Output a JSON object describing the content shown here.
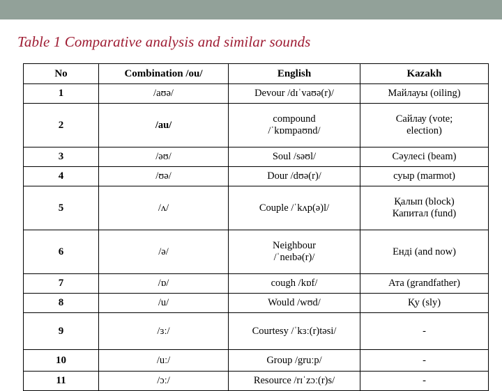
{
  "banner": {
    "color": "#92a199"
  },
  "title": {
    "text": "Table 1 Comparative analysis and similar sounds",
    "color": "#9e1b32"
  },
  "table": {
    "columns": [
      "No",
      "Combination /ou/",
      "English",
      "Kazakh"
    ],
    "rows": [
      {
        "no": "1",
        "combination": "/aʊə/",
        "combination_bold": false,
        "english_line1": "Devour /dɪˈvaʊə(r)/",
        "english_line2": "",
        "kazakh_line1": "Майлауы (oiling)",
        "kazakh_line2": ""
      },
      {
        "no": "2",
        "combination": "/au/",
        "combination_bold": true,
        "english_line1": "compound",
        "english_line2": "/ˈkɒmpaʊnd/",
        "kazakh_line1": "Сайлау (vote;",
        "kazakh_line2": "election)"
      },
      {
        "no": "3",
        "combination": "/əʊ/",
        "combination_bold": false,
        "english_line1": "Soul /səʊl/",
        "english_line2": "",
        "kazakh_line1": "Сәулесі (beam)",
        "kazakh_line2": ""
      },
      {
        "no": "4",
        "combination": "/ʊə/",
        "combination_bold": false,
        "english_line1": "Dour /dʊə(r)/",
        "english_line2": "",
        "kazakh_line1": "суыр (marmot)",
        "kazakh_line2": ""
      },
      {
        "no": "5",
        "combination": "/ʌ/",
        "combination_bold": false,
        "english_line1": "Couple /ˈkʌp(ə)l/",
        "english_line2": "",
        "kazakh_line1": "Қалып (block)",
        "kazakh_line2": "Капитал (fund)"
      },
      {
        "no": "6",
        "combination": "/ə/",
        "combination_bold": false,
        "english_line1": "Neighbour",
        "english_line2": "/ˈneɪbə(r)/",
        "kazakh_line1": "Енді (and now)",
        "kazakh_line2": ""
      },
      {
        "no": "7",
        "combination": "/ɒ/",
        "combination_bold": false,
        "english_line1": "cough /kɒf/",
        "english_line2": "",
        "kazakh_line1": "Ата (grandfather)",
        "kazakh_line2": ""
      },
      {
        "no": "8",
        "combination": "/u/",
        "combination_bold": false,
        "english_line1": "Would /wʊd/",
        "english_line2": "",
        "kazakh_line1": "Қу (sly)",
        "kazakh_line2": ""
      },
      {
        "no": "9",
        "combination": "/ɜː/",
        "combination_bold": false,
        "english_line1": "Courtesy /ˈkɜː(r)təsi/",
        "english_line2": "",
        "kazakh_line1": "-",
        "kazakh_line2": ""
      },
      {
        "no": "10",
        "combination": "/uː/",
        "combination_bold": false,
        "english_line1": "Group /gruːp/",
        "english_line2": "",
        "kazakh_line1": "-",
        "kazakh_line2": ""
      },
      {
        "no": "11",
        "combination": "/ɔː/",
        "combination_bold": false,
        "english_line1": "Resource /rɪˈzɔː(r)s/",
        "english_line2": "",
        "kazakh_line1": "-",
        "kazakh_line2": ""
      }
    ]
  }
}
